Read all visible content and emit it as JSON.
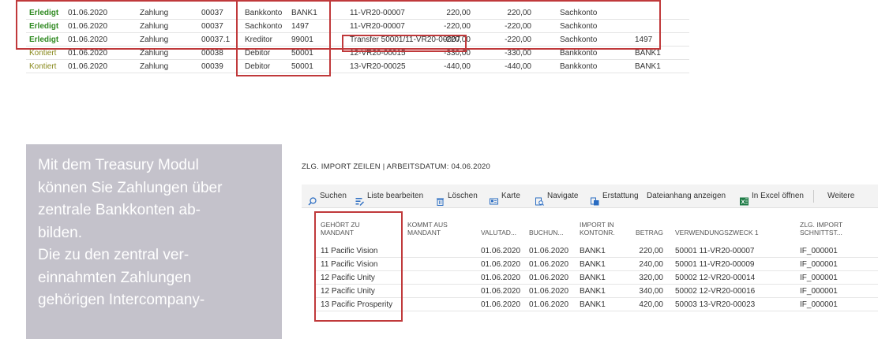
{
  "top_table": {
    "rows": [
      {
        "status": "Erledigt",
        "date": "01.06.2020",
        "type": "Zahlung",
        "doc": "00037",
        "account_type": "Bankkonto",
        "account_no": "BANK1",
        "text": "11-VR20-00007",
        "amount": "220,00",
        "amount2": "220,00",
        "counter_type": "Sachkonto",
        "counter_no": ""
      },
      {
        "status": "Erledigt",
        "date": "01.06.2020",
        "type": "Zahlung",
        "doc": "00037",
        "account_type": "Sachkonto",
        "account_no": "1497",
        "text": "11-VR20-00007",
        "amount": "-220,00",
        "amount2": "-220,00",
        "counter_type": "Sachkonto",
        "counter_no": ""
      },
      {
        "status": "Erledigt",
        "date": "01.06.2020",
        "type": "Zahlung",
        "doc": "00037.1",
        "account_type": "Kreditor",
        "account_no": "99001",
        "text": "Transfer 50001/11-VR20-00007",
        "amount": "-220,00",
        "amount2": "-220,00",
        "counter_type": "Sachkonto",
        "counter_no": "1497"
      },
      {
        "status": "Kontiert",
        "date": "01.06.2020",
        "type": "Zahlung",
        "doc": "00038",
        "account_type": "Debitor",
        "account_no": "50001",
        "text": "12-VR20-00015",
        "amount": "-330,00",
        "amount2": "-330,00",
        "counter_type": "Bankkonto",
        "counter_no": "BANK1"
      },
      {
        "status": "Kontiert",
        "date": "01.06.2020",
        "type": "Zahlung",
        "doc": "00039",
        "account_type": "Debitor",
        "account_no": "50001",
        "text": "13-VR20-00025",
        "amount": "-440,00",
        "amount2": "-440,00",
        "counter_type": "Bankkonto",
        "counter_no": "BANK1"
      }
    ]
  },
  "info_panel": {
    "lines": [
      "Mit dem Treasury Modul",
      "können Sie Zahlungen über",
      "zentrale Bankkonten ab-",
      "bilden.",
      "Die zu den zentral ver-",
      "einnahmten Zahlungen",
      "gehörigen Intercompany-"
    ]
  },
  "import_page": {
    "title": "ZLG. IMPORT ZEILEN | ARBEITSDATUM: 04.06.2020",
    "actions": {
      "search": "Suchen",
      "edit_list": "Liste bearbeiten",
      "delete": "Löschen",
      "card": "Karte",
      "navigate": "Navigate",
      "refund": "Erstattung",
      "attachments": "Dateianhang anzeigen",
      "excel": "In Excel öffnen",
      "more": "Weitere"
    },
    "columns": {
      "mandant_1": "GEHÖRT ZU",
      "mandant_2": "MANDANT",
      "from_1": "KOMMT AUS",
      "from_2": "MANDANT",
      "valuta": "VALUTAD...",
      "buchung": "BUCHUN...",
      "import_1": "IMPORT IN",
      "import_2": "KONTONR.",
      "betrag": "BETRAG",
      "zweck": "VERWENDUNGSZWECK 1",
      "schnitt_1": "ZLG. IMPORT",
      "schnitt_2": "SCHNITTST..."
    },
    "rows": [
      {
        "mandant": "11 Pacific Vision",
        "valuta": "01.06.2020",
        "buchung": "01.06.2020",
        "import": "BANK1",
        "betrag": "220,00",
        "zweck": "50001 11-VR20-00007",
        "schnitt": "IF_000001"
      },
      {
        "mandant": "11 Pacific Vision",
        "valuta": "01.06.2020",
        "buchung": "01.06.2020",
        "import": "BANK1",
        "betrag": "240,00",
        "zweck": "50001 11-VR20-00009",
        "schnitt": "IF_000001"
      },
      {
        "mandant": "12 Pacific Unity",
        "valuta": "01.06.2020",
        "buchung": "01.06.2020",
        "import": "BANK1",
        "betrag": "320,00",
        "zweck": "50002 12-VR20-00014",
        "schnitt": "IF_000001"
      },
      {
        "mandant": "12 Pacific Unity",
        "valuta": "01.06.2020",
        "buchung": "01.06.2020",
        "import": "BANK1",
        "betrag": "340,00",
        "zweck": "50002 12-VR20-00016",
        "schnitt": "IF_000001"
      },
      {
        "mandant": "13 Pacific Prosperity",
        "valuta": "01.06.2020",
        "buchung": "01.06.2020",
        "import": "BANK1",
        "betrag": "420,00",
        "zweck": "50003 13-VR20-00023",
        "schnitt": "IF_000001"
      }
    ]
  },
  "colors": {
    "highlight": "#c0393b",
    "status_done": "#2f8a21",
    "status_posted": "#8a8a1e",
    "panel_bg": "#c4c2cb"
  }
}
